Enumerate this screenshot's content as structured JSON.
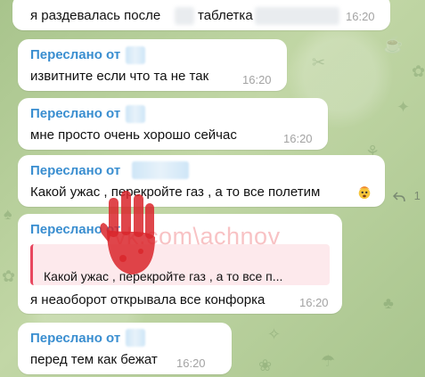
{
  "messages": [
    {
      "forwarded_label": "",
      "text": "я раздевалась после",
      "text_tail": "таблетка",
      "time": "16:20"
    },
    {
      "forwarded_label": "Переслано от",
      "text": "извитните если что та не так",
      "time": "16:20"
    },
    {
      "forwarded_label": "Переслано от",
      "text": "мне просто очень хорошо сейчас",
      "time": "16:20"
    },
    {
      "forwarded_label": "Переслано от",
      "text": "Какой ужас , перекройте газ , а то все полетим",
      "time": "16:20"
    },
    {
      "forwarded_label": "Переслано от",
      "quote": "Какой ужас , перекройте газ , а то все п...",
      "text": "я неаоборот открывала все конфорка",
      "time": "16:20"
    },
    {
      "forwarded_label": "Переслано от",
      "text": "перед тем как бежат",
      "time": "16:20"
    }
  ],
  "reply_count": "1",
  "watermark_text": "vk.com\\achnov",
  "icons": {
    "reply": "reply-arrow-icon",
    "emoji": "exploding-head-emoji-icon",
    "hand": "red-hand-stamp-icon"
  },
  "colors": {
    "forward_label": "#3a8ed0",
    "quote_border": "#e8475f",
    "quote_bg": "#fde9ec",
    "time": "#a3a3a3",
    "watermark": "#e7343a"
  }
}
